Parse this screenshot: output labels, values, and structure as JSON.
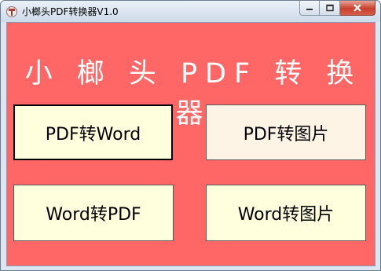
{
  "window": {
    "title": "小榔头PDF转换器V1.0",
    "icon": "hammer-app-icon",
    "controls": {
      "minimize_icon": "minimize-icon",
      "maximize_icon": "maximize-icon",
      "close_icon": "close-icon"
    }
  },
  "main": {
    "heading": "小 榔 头  PDF 转 换 器",
    "buttons": [
      {
        "label": "PDF转Word"
      },
      {
        "label": "PDF转图片"
      },
      {
        "label": "Word转PDF"
      },
      {
        "label": "Word转图片"
      }
    ]
  },
  "colors": {
    "background": "#ff6666",
    "button_fill": "#ffffdd",
    "button_hover_fill": "#fdf4e6",
    "heading_text": "#ffffff"
  }
}
